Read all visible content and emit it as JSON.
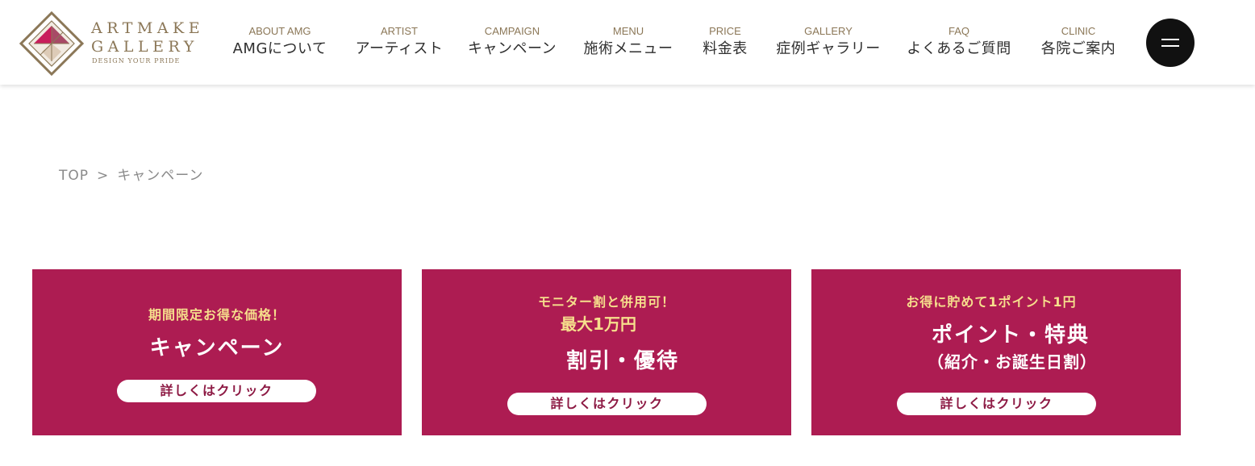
{
  "brand": {
    "name_line1": "ARTMAKE",
    "name_line2": "GALLERY",
    "tagline": "DESIGN YOUR PRIDE",
    "color_gold": "#8b7757",
    "color_crimson": "#ad1c52"
  },
  "nav": [
    {
      "en": "ABOUT AMG",
      "ja": "AMGについて"
    },
    {
      "en": "ARTIST",
      "ja": "アーティスト"
    },
    {
      "en": "CAMPAIGN",
      "ja": "キャンペーン"
    },
    {
      "en": "MENU",
      "ja": "施術メニュー"
    },
    {
      "en": "PRICE",
      "ja": "料金表"
    },
    {
      "en": "GALLERY",
      "ja": "症例ギャラリー"
    },
    {
      "en": "FAQ",
      "ja": "よくあるご質問"
    },
    {
      "en": "CLINIC",
      "ja": "各院ご案内"
    }
  ],
  "menu_button": {
    "icon": "hamburger-icon"
  },
  "breadcrumb": {
    "home": "TOP",
    "separator": ">",
    "current": "キャンペーン"
  },
  "cards": [
    {
      "lead": "期間限定お得な価格！",
      "title": "キャンペーン",
      "button": "詳しくはクリック"
    },
    {
      "lead": "モニター割と併用可！",
      "highlight": "最大1万円",
      "title": "割引・優待",
      "button": "詳しくはクリック"
    },
    {
      "lead": "お得に貯めて1ポイント1円",
      "title": "ポイント・特典",
      "subtitle": "（紹介・お誕生日割）",
      "button": "詳しくはクリック"
    }
  ]
}
